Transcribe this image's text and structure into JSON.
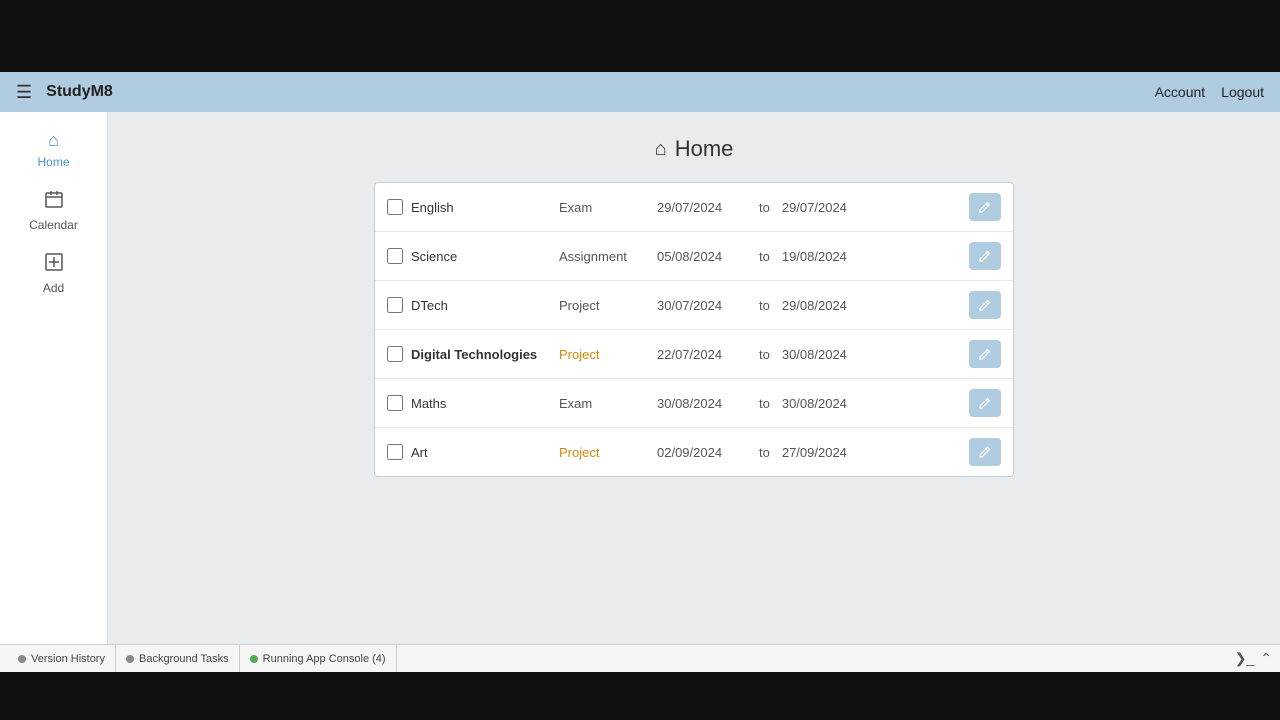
{
  "topBar": {
    "brandName": "StudyM8",
    "accountLabel": "Account",
    "logoutLabel": "Logout"
  },
  "sidebar": {
    "items": [
      {
        "id": "home",
        "label": "Home",
        "icon": "⌂",
        "active": true
      },
      {
        "id": "calendar",
        "label": "Calendar",
        "icon": "▦"
      },
      {
        "id": "add",
        "label": "Add",
        "icon": "⊞"
      }
    ]
  },
  "page": {
    "title": "Home",
    "homeIcon": "⌂"
  },
  "tasks": [
    {
      "subject": "English",
      "type": "Exam",
      "typeStyle": "normal",
      "subjectBold": false,
      "dateStart": "29/07/2024",
      "dateTo": "to",
      "dateEnd": "29/07/2024"
    },
    {
      "subject": "Science",
      "type": "Assignment",
      "typeStyle": "normal",
      "subjectBold": false,
      "dateStart": "05/08/2024",
      "dateTo": "to",
      "dateEnd": "19/08/2024"
    },
    {
      "subject": "DTech",
      "type": "Project",
      "typeStyle": "normal",
      "subjectBold": false,
      "dateStart": "30/07/2024",
      "dateTo": "to",
      "dateEnd": "29/08/2024"
    },
    {
      "subject": "Digital Technologies",
      "type": "Project",
      "typeStyle": "orange",
      "subjectBold": true,
      "dateStart": "22/07/2024",
      "dateTo": "to",
      "dateEnd": "30/08/2024"
    },
    {
      "subject": "Maths",
      "type": "Exam",
      "typeStyle": "normal",
      "subjectBold": false,
      "dateStart": "30/08/2024",
      "dateTo": "to",
      "dateEnd": "30/08/2024"
    },
    {
      "subject": "Art",
      "type": "Project",
      "typeStyle": "orange",
      "subjectBold": false,
      "dateStart": "02/09/2024",
      "dateTo": "to",
      "dateEnd": "27/09/2024"
    }
  ],
  "bottomBar": {
    "tabs": [
      {
        "id": "version-history",
        "label": "Version History",
        "dotColor": "gray"
      },
      {
        "id": "background-tasks",
        "label": "Background Tasks",
        "dotColor": "gray"
      },
      {
        "id": "running-app-console",
        "label": "Running App Console (4)",
        "dotColor": "green"
      }
    ]
  }
}
